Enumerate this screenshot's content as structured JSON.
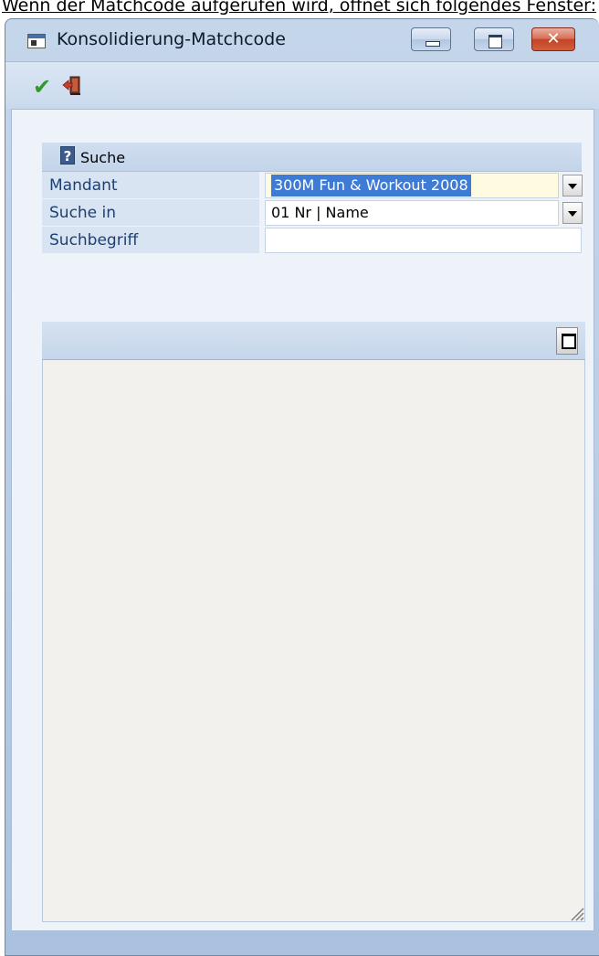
{
  "caption": "Wenn der Matchcode aufgerufen wird, öffnet sich folgendes Fenster:",
  "window": {
    "title": "Konsolidierung-Matchcode",
    "controls": {
      "minimize": "minimize-icon",
      "maximize": "maximize-icon",
      "close_glyph": "✕"
    }
  },
  "toolbar": {
    "ok_glyph": "✔",
    "ok_icon": "checkmark-icon",
    "exit_icon": "exit-door-icon",
    "ok_color": "#2f9a2a"
  },
  "search": {
    "group_title": "Suche",
    "help_glyph": "?",
    "rows": [
      {
        "label": "Mandant",
        "value": "300M Fun & Workout 2008",
        "has_dropdown": true,
        "selected": true
      },
      {
        "label": "Suche in",
        "value": "01 Nr | Name",
        "has_dropdown": true,
        "selected": false
      },
      {
        "label": "Suchbegriff",
        "value": "",
        "has_dropdown": false,
        "selected": false
      }
    ]
  },
  "results": {
    "toggle_icon": "maximize-grid-icon"
  },
  "colors": {
    "label_text": "#1d3f73",
    "label_bg": "#d8e4f2",
    "selection": "#3d7bd4",
    "close_button": "#c44426"
  }
}
